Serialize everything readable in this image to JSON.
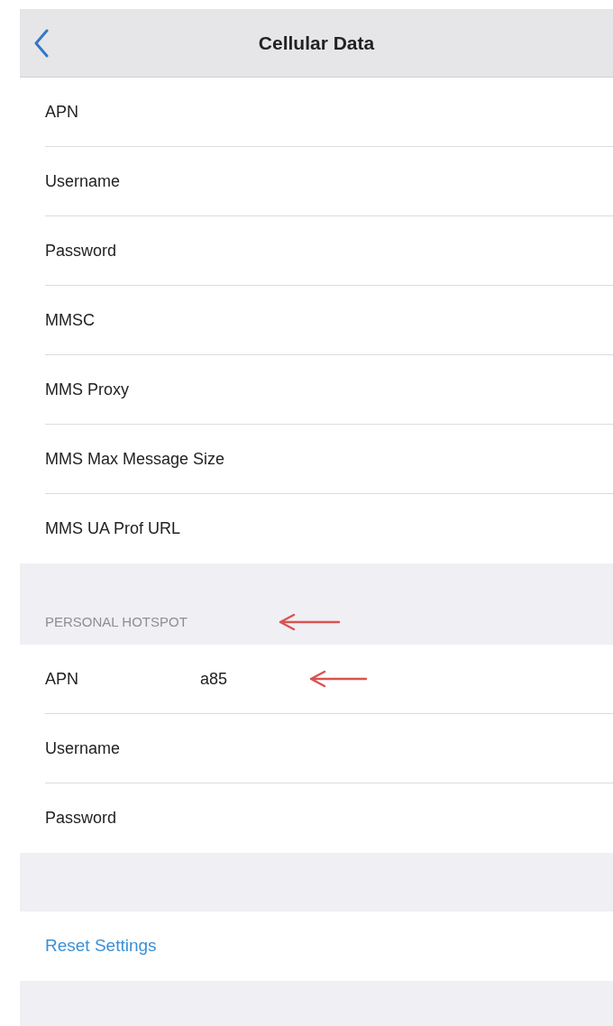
{
  "nav": {
    "title": "Cellular Data"
  },
  "sections": [
    {
      "rows": [
        {
          "label": "APN"
        },
        {
          "label": "Username"
        },
        {
          "label": "Password"
        },
        {
          "label": "MMSC"
        },
        {
          "label": "MMS Proxy"
        },
        {
          "label": "MMS Max Message Size"
        },
        {
          "label": "MMS UA Prof URL"
        }
      ]
    },
    {
      "header": "PERSONAL HOTSPOT",
      "rows": [
        {
          "label": "APN",
          "value": "a85"
        },
        {
          "label": "Username"
        },
        {
          "label": "Password"
        }
      ]
    }
  ],
  "reset": {
    "label": "Reset Settings"
  }
}
